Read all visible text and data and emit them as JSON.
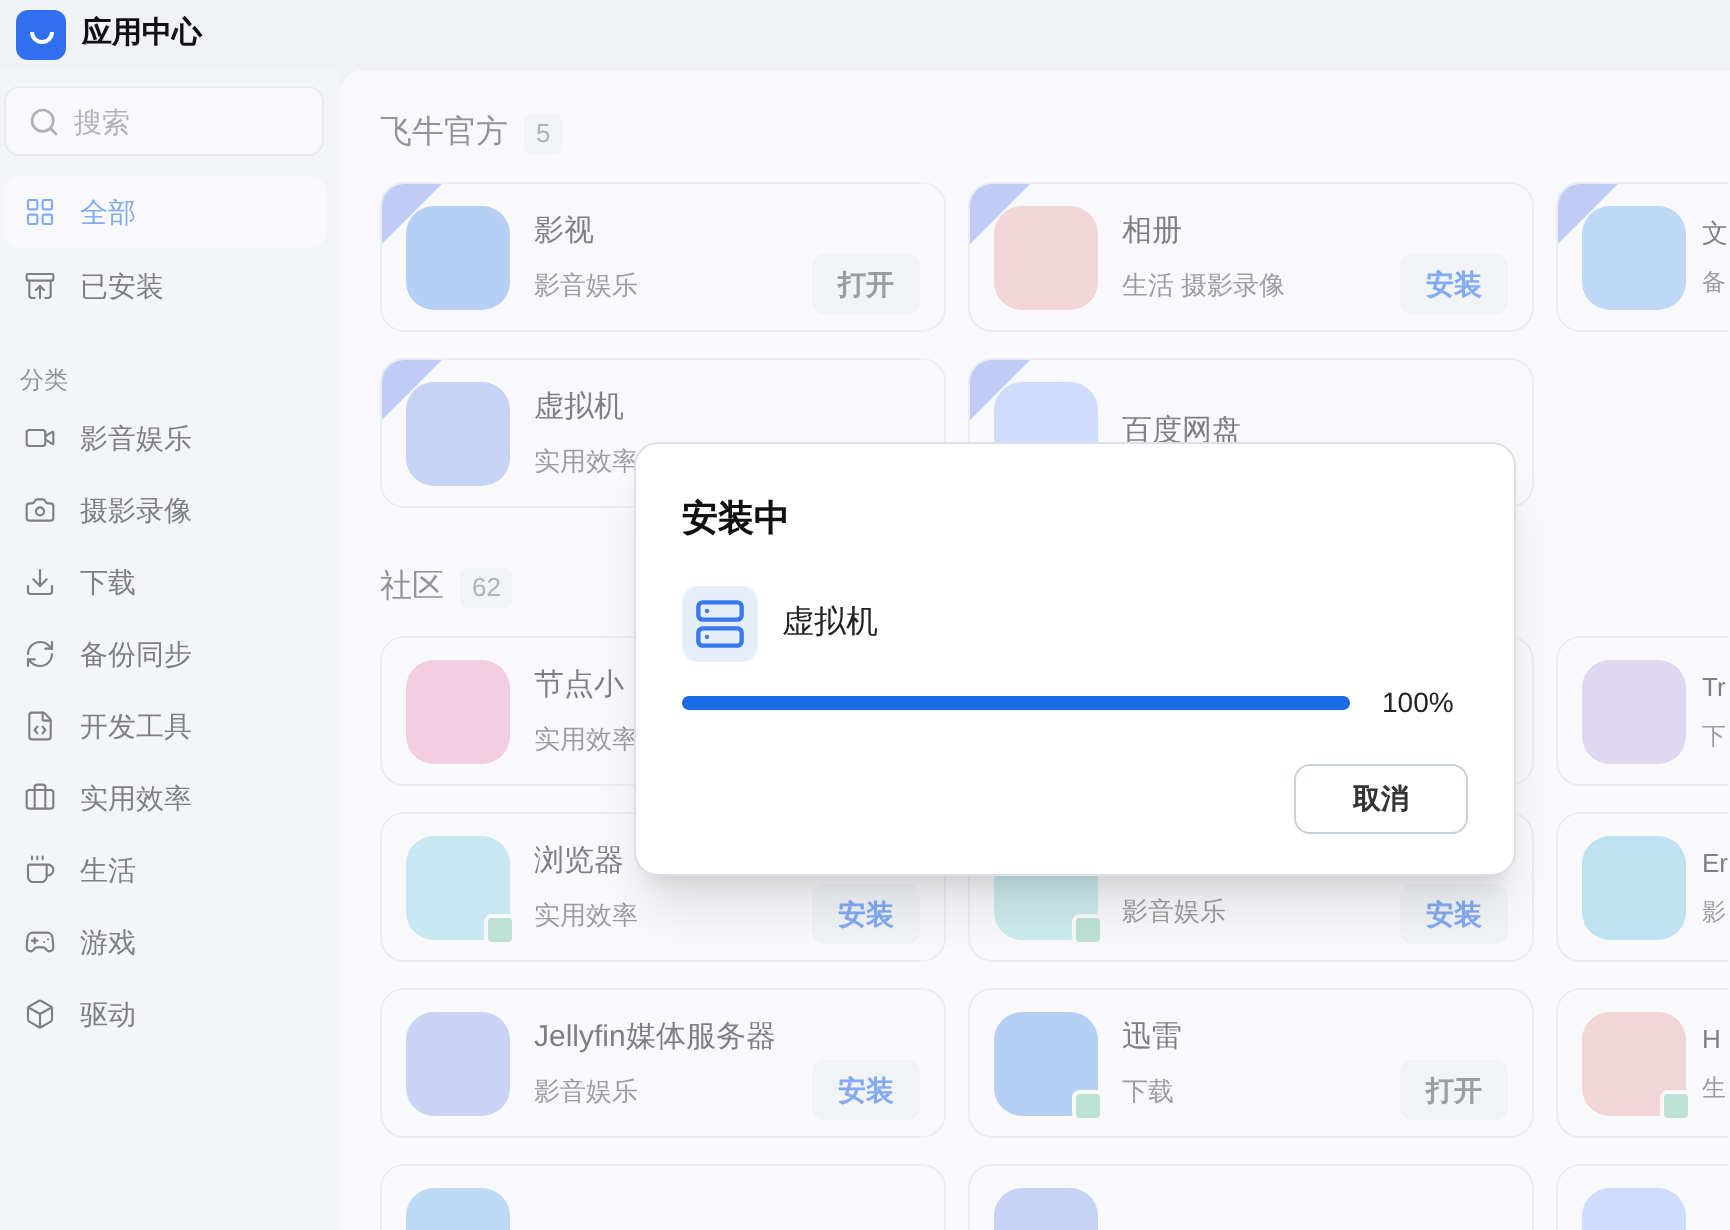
{
  "window": {
    "title": "应用中心"
  },
  "sidebar": {
    "search": {
      "placeholder": "搜索"
    },
    "items": [
      {
        "label": "全部",
        "selected": true
      },
      {
        "label": "已安装",
        "selected": false
      }
    ],
    "category_heading": "分类",
    "categories": [
      {
        "label": "影音娱乐",
        "selected": false
      },
      {
        "label": "摄影录像",
        "selected": false
      },
      {
        "label": "下载",
        "selected": false
      },
      {
        "label": "备份同步",
        "selected": false
      },
      {
        "label": "开发工具",
        "selected": false
      },
      {
        "label": "实用效率",
        "selected": false
      },
      {
        "label": "生活",
        "selected": false
      },
      {
        "label": "游戏",
        "selected": false
      },
      {
        "label": "驱动",
        "selected": false
      }
    ]
  },
  "sections": [
    {
      "title": "飞牛官方",
      "count": "5",
      "rows": [
        [
          {
            "name": "影视",
            "category": "影音娱乐",
            "button": {
              "kind": "open",
              "label": "打开"
            },
            "official": true,
            "third_party": false
          },
          {
            "name": "相册",
            "category": "生活 摄影录像",
            "button": {
              "kind": "install",
              "label": "安装"
            },
            "official": true,
            "third_party": false
          },
          {
            "name": "文",
            "category": "备",
            "official": true,
            "third_party": false
          }
        ],
        [
          {
            "name": "虚拟机",
            "category": "实用效率",
            "official": true,
            "third_party": false
          },
          {
            "name": "百度网盘",
            "official": true,
            "third_party": false
          }
        ]
      ]
    },
    {
      "title": "社区",
      "count": "62",
      "rows": [
        [
          {
            "name": "节点小",
            "category": "实用效率",
            "official": false,
            "third_party": false
          },
          {},
          {
            "name": "Tr",
            "category": "下",
            "official": false,
            "third_party": false
          }
        ],
        [
          {
            "name": "浏览器",
            "category": "实用效率",
            "button": {
              "kind": "install",
              "label": "安装"
            },
            "official": false,
            "third_party": true
          },
          {
            "category": "影音娱乐",
            "button": {
              "kind": "install",
              "label": "安装"
            },
            "official": false,
            "third_party": true
          },
          {
            "name": "Er",
            "category": "影",
            "official": false,
            "third_party": false
          }
        ],
        [
          {
            "name": "Jellyfin媒体服务器",
            "category": "影音娱乐",
            "button": {
              "kind": "install",
              "label": "安装"
            },
            "official": false,
            "third_party": false
          },
          {
            "name": "迅雷",
            "category": "下载",
            "button": {
              "kind": "open",
              "label": "打开"
            },
            "official": false,
            "third_party": true
          },
          {
            "name": "H",
            "category": "生",
            "official": false,
            "third_party": true
          }
        ],
        [
          {
            "official": false
          },
          {
            "official": false
          },
          {
            "official": false
          }
        ]
      ]
    }
  ],
  "dialog": {
    "title": "安装中",
    "app_name": "虚拟机",
    "progress": {
      "level": 1.0,
      "reading": "100%"
    },
    "buttons": [
      "取消"
    ]
  }
}
